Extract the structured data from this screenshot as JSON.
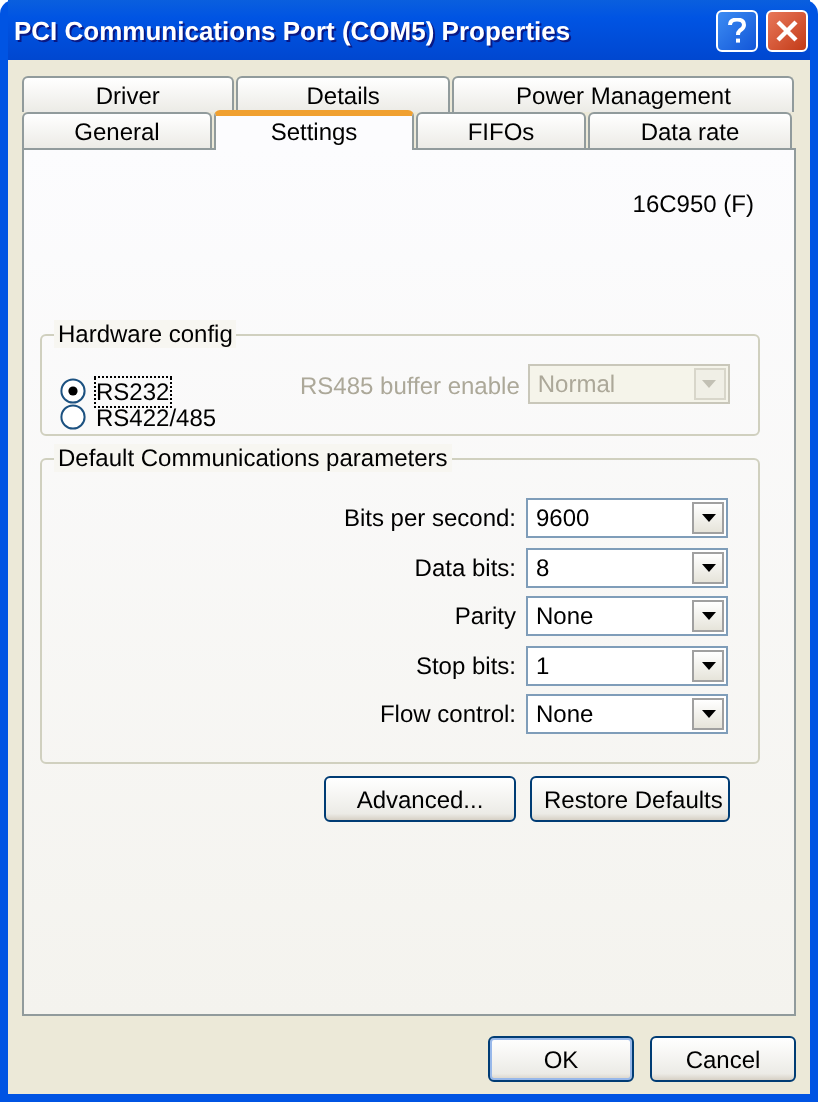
{
  "window": {
    "title": "PCI Communications Port (COM5) Properties"
  },
  "tab_rows": [
    {
      "tabs": [
        {
          "label": "Driver",
          "selected": false
        },
        {
          "label": "Details",
          "selected": false
        },
        {
          "label": "Power Management",
          "selected": false
        }
      ]
    },
    {
      "tabs": [
        {
          "label": "General",
          "selected": false
        },
        {
          "label": "Settings",
          "selected": true
        },
        {
          "label": "FIFOs",
          "selected": false
        },
        {
          "label": "Data rate",
          "selected": false
        }
      ]
    }
  ],
  "device_type": "16C950 (F)",
  "hardware_config": {
    "title": "Hardware config",
    "options": [
      {
        "label": "RS232",
        "selected": true
      },
      {
        "label": "RS422/485",
        "selected": false
      }
    ],
    "buffer_enable": {
      "label": "RS485 buffer enable",
      "value": "Normal",
      "disabled": true
    }
  },
  "comm_params": {
    "title": "Default Communications parameters",
    "fields": [
      {
        "label": "Bits per second:",
        "value": "9600"
      },
      {
        "label": "Data bits:",
        "value": "8"
      },
      {
        "label": "Parity",
        "value": "None"
      },
      {
        "label": "Stop bits:",
        "value": "1"
      },
      {
        "label": "Flow control:",
        "value": "None"
      }
    ]
  },
  "panel_buttons": [
    {
      "label": "Advanced..."
    },
    {
      "label": "Restore Defaults"
    }
  ],
  "dialog_buttons": [
    {
      "label": "OK",
      "default": true
    },
    {
      "label": "Cancel",
      "default": false
    }
  ]
}
